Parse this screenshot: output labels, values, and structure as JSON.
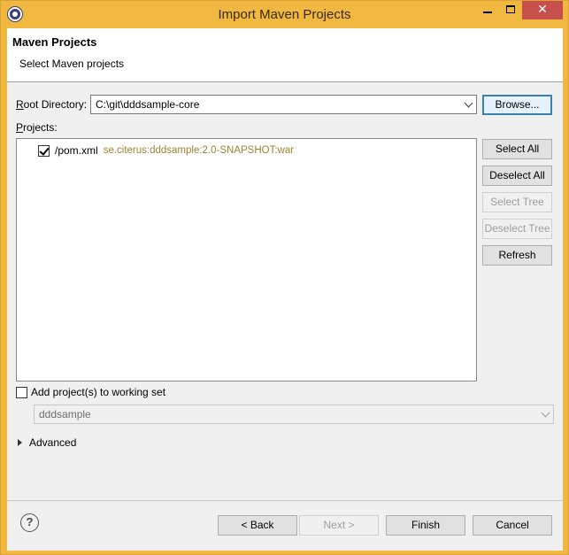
{
  "window": {
    "title": "Import Maven Projects",
    "icon": "eclipse-icon",
    "minimize_glyph": "",
    "maximize_glyph": "",
    "close_glyph": "✕"
  },
  "header": {
    "title": "Maven Projects",
    "subtitle": "Select Maven projects"
  },
  "root_directory": {
    "label_prefix": "R",
    "label_rest": "oot Directory:",
    "value": "C:\\git\\dddsample-core",
    "browse_label": "Browse..."
  },
  "projects": {
    "label_prefix": "P",
    "label_rest": "rojects:",
    "items": [
      {
        "checked": true,
        "file": "/pom.xml",
        "gav": "se.citerus:dddsample:2.0-SNAPSHOT:war"
      }
    ]
  },
  "side_buttons": {
    "select_all": "Select All",
    "deselect_all": "Deselect All",
    "select_tree": "Select Tree",
    "deselect_tree": "Deselect Tree",
    "refresh": "Refresh"
  },
  "working_set": {
    "checkbox_label": "Add project(s) to working set",
    "checked": false,
    "value": "dddsample"
  },
  "advanced": {
    "label": "Advanced"
  },
  "footer": {
    "help_glyph": "?",
    "back_label": "< Back",
    "next_label": "Next >",
    "finish_label": "Finish",
    "cancel_label": "Cancel"
  },
  "colors": {
    "titlebar": "#f0b840",
    "close_button": "#c7504c",
    "gav_text": "#a08030"
  }
}
